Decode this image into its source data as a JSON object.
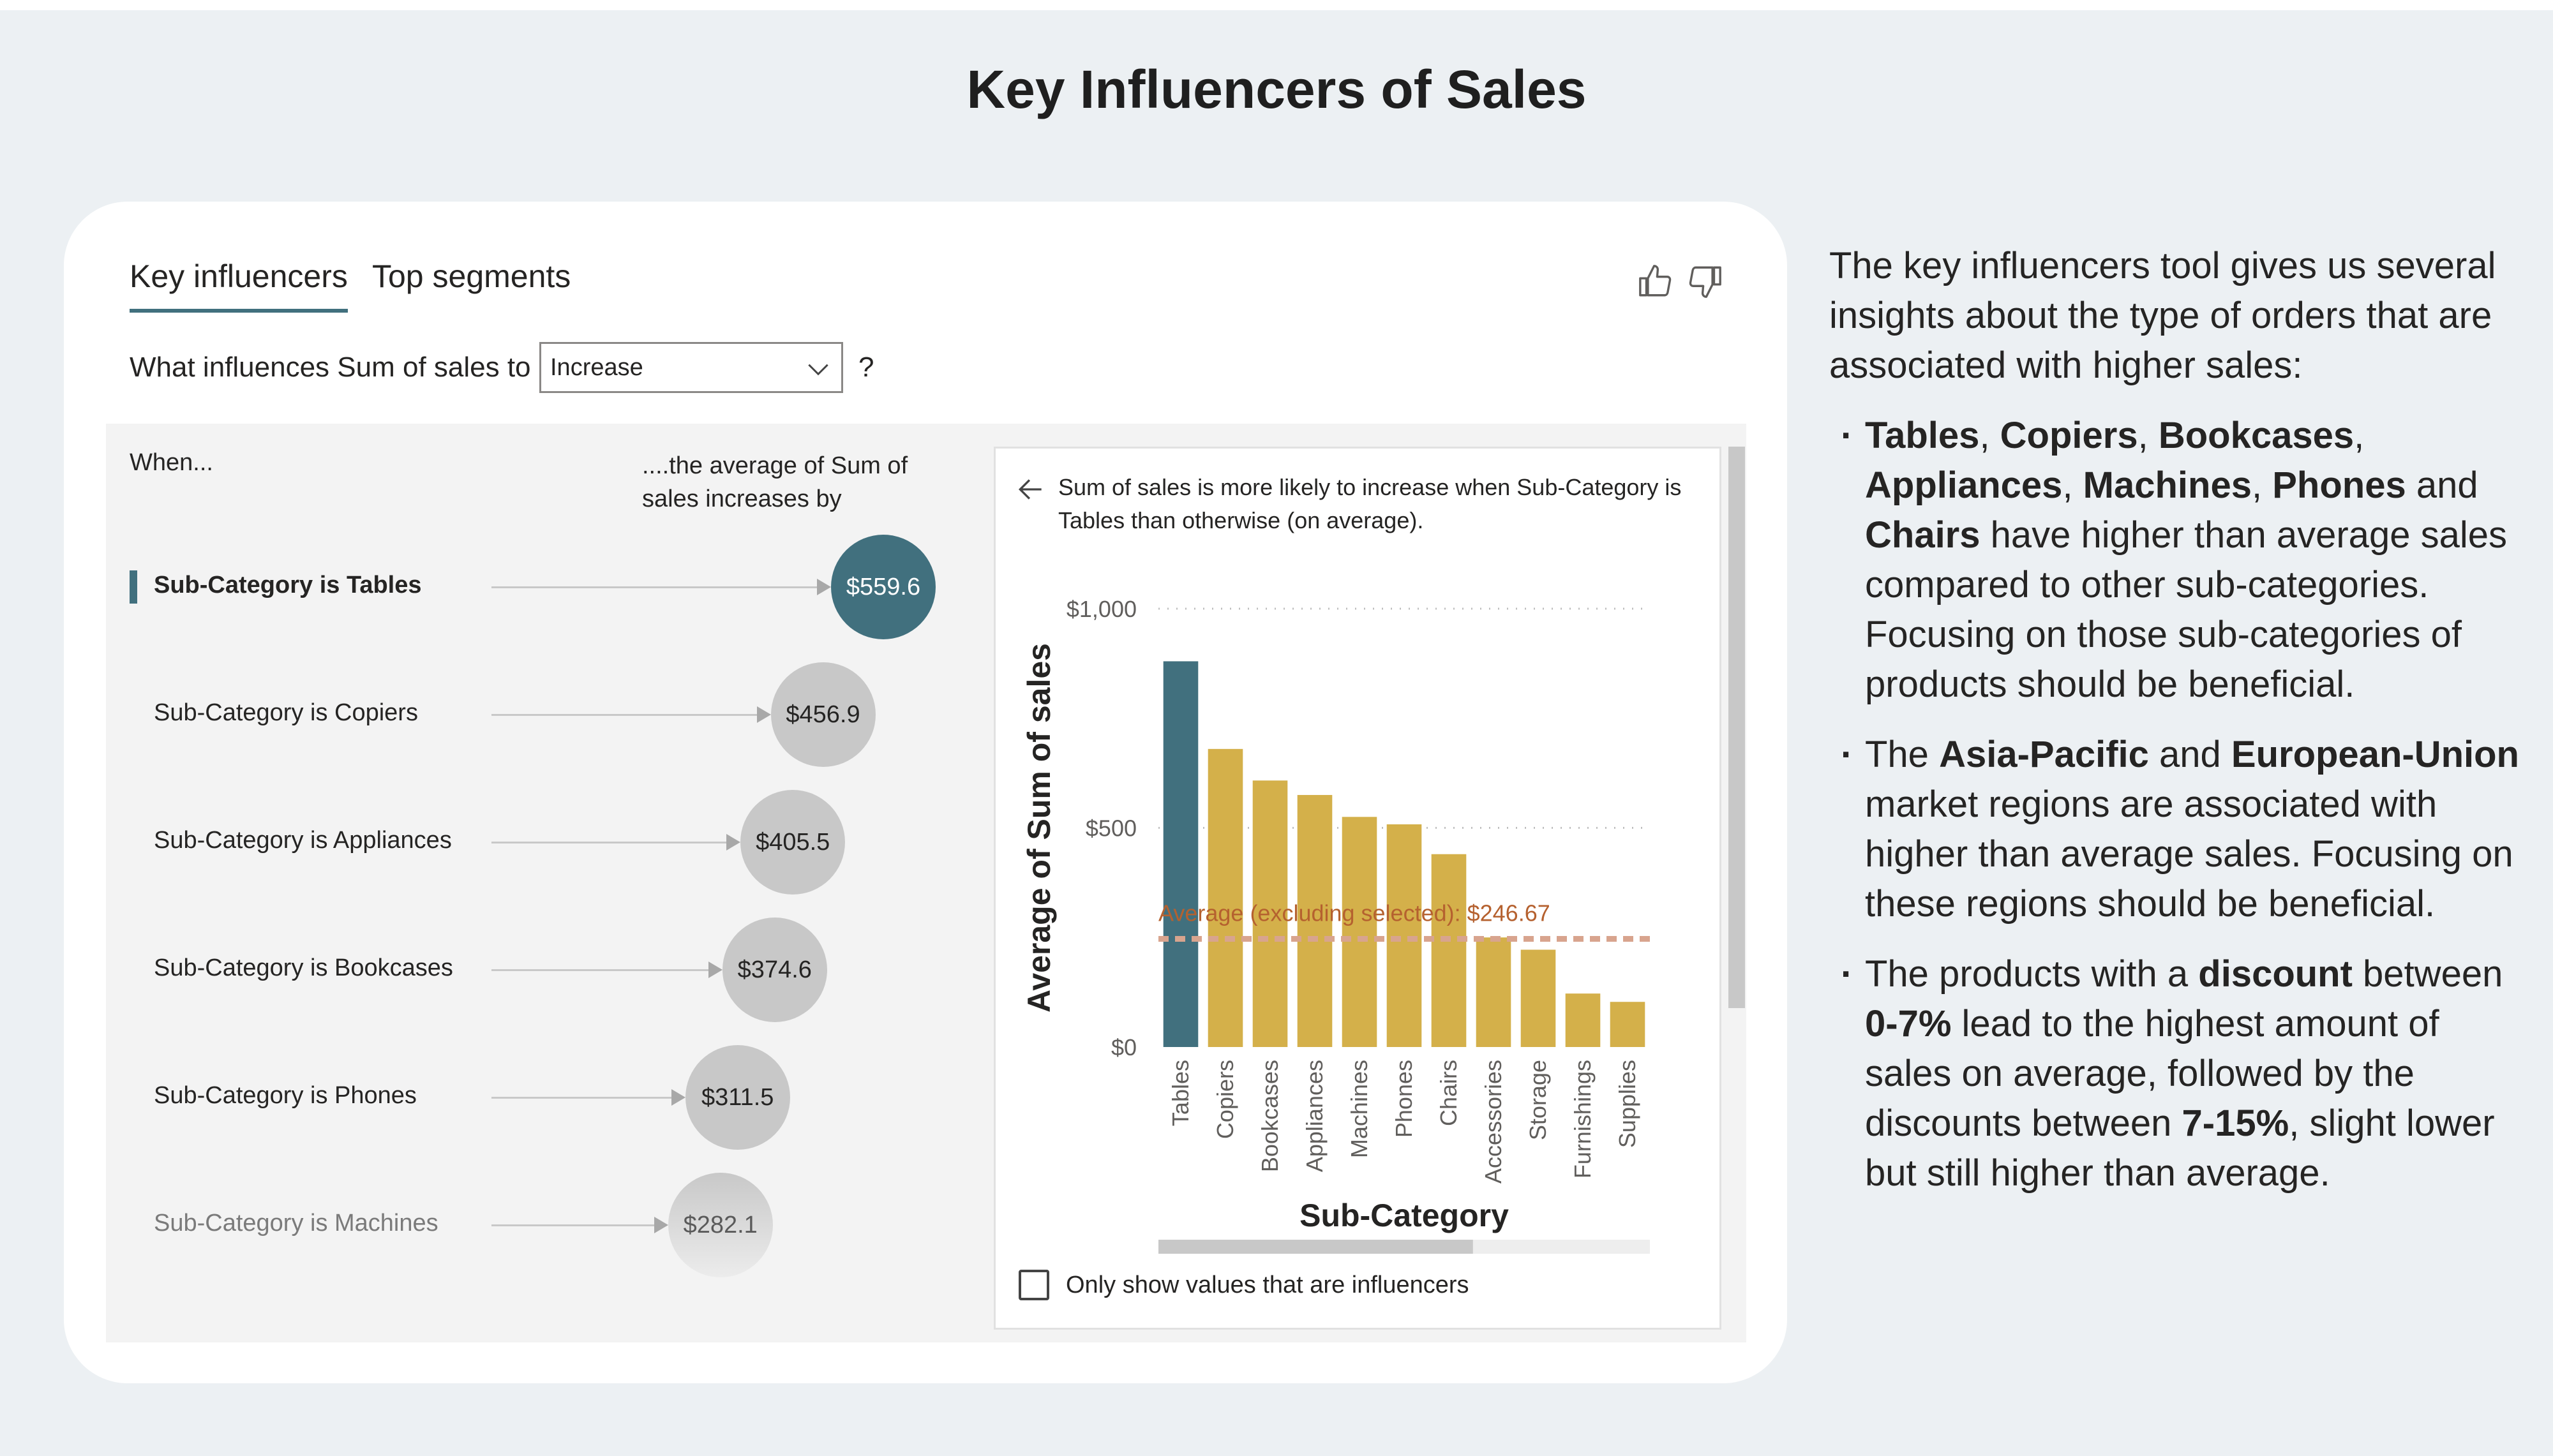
{
  "page": {
    "title": "Key Influencers of Sales"
  },
  "visual": {
    "tabs": [
      {
        "label": "Key influencers",
        "active": true
      },
      {
        "label": "Top segments",
        "active": false
      }
    ],
    "thumbs_up_icon": "thumbs-up-icon",
    "thumbs_down_icon": "thumbs-down-icon",
    "question": {
      "prefix": "What influences Sum of sales to",
      "selected": "Increase",
      "suffix": "?"
    },
    "col_when": "When...",
    "col_avg": "....the average of Sum of sales increases by",
    "influencers": [
      {
        "label": "Sub-Category is Tables",
        "value": "$559.6",
        "selected": true
      },
      {
        "label": "Sub-Category is Copiers",
        "value": "$456.9"
      },
      {
        "label": "Sub-Category is Appliances",
        "value": "$405.5"
      },
      {
        "label": "Sub-Category is Bookcases",
        "value": "$374.6"
      },
      {
        "label": "Sub-Category is Phones",
        "value": "$311.5"
      },
      {
        "label": "Sub-Category is Machines",
        "value": "$282.1",
        "faded": true
      }
    ],
    "detail": {
      "text": "Sum of sales is more likely to increase when Sub-Category is Tables than otherwise (on average).",
      "checkbox_label": "Only show values that are influencers"
    }
  },
  "chart_data": {
    "type": "bar",
    "categories": [
      "Tables",
      "Copiers",
      "Bookcases",
      "Appliances",
      "Machines",
      "Phones",
      "Chairs",
      "Accessories",
      "Storage",
      "Furnishings",
      "Supplies"
    ],
    "values": [
      880,
      680,
      608,
      575,
      525,
      508,
      440,
      250,
      222,
      122,
      103
    ],
    "highlighted": "Tables",
    "xlabel": "Sub-Category",
    "ylabel": "Average of Sum of sales",
    "ylim": [
      0,
      1000
    ],
    "yticks": [
      {
        "v": 0,
        "label": "$0"
      },
      {
        "v": 500,
        "label": "$500"
      },
      {
        "v": 1000,
        "label": "$1,000"
      }
    ],
    "average": {
      "value": 246.67,
      "label": "Average (excluding selected): $246.67"
    },
    "colors": {
      "highlight": "#41707e",
      "bar": "#d4b04a",
      "average": "#d8a48e",
      "average_text": "#b5612f"
    }
  },
  "sidebar": {
    "intro": "The key influencers tool gives us several insights about the type of orders that are associated with higher sales:",
    "bullets": [
      [
        {
          "t": "Tables",
          "b": true
        },
        {
          "t": ", "
        },
        {
          "t": "Copiers",
          "b": true
        },
        {
          "t": ", "
        },
        {
          "t": "Bookcases",
          "b": true
        },
        {
          "t": ", "
        },
        {
          "t": "Appliances",
          "b": true
        },
        {
          "t": ", "
        },
        {
          "t": "Machines",
          "b": true
        },
        {
          "t": ", "
        },
        {
          "t": "Phones",
          "b": true
        },
        {
          "t": " and "
        },
        {
          "t": "Chairs",
          "b": true
        },
        {
          "t": " have higher than average sales compared to other sub-categories. Focusing on those sub-categories of products should be beneficial."
        }
      ],
      [
        {
          "t": "The "
        },
        {
          "t": "Asia-Pacific",
          "b": true
        },
        {
          "t": " and "
        },
        {
          "t": "European-Union",
          "b": true
        },
        {
          "t": " market regions are associated with higher than average sales. Focusing on these regions should be beneficial."
        }
      ],
      [
        {
          "t": "The products with a "
        },
        {
          "t": "discount",
          "b": true
        },
        {
          "t": " between "
        },
        {
          "t": "0-7%",
          "b": true
        },
        {
          "t": " lead to the highest amount of sales on average, followed by the discounts between "
        },
        {
          "t": "7-15%",
          "b": true
        },
        {
          "t": ", slight lower but still higher than average."
        }
      ]
    ]
  }
}
